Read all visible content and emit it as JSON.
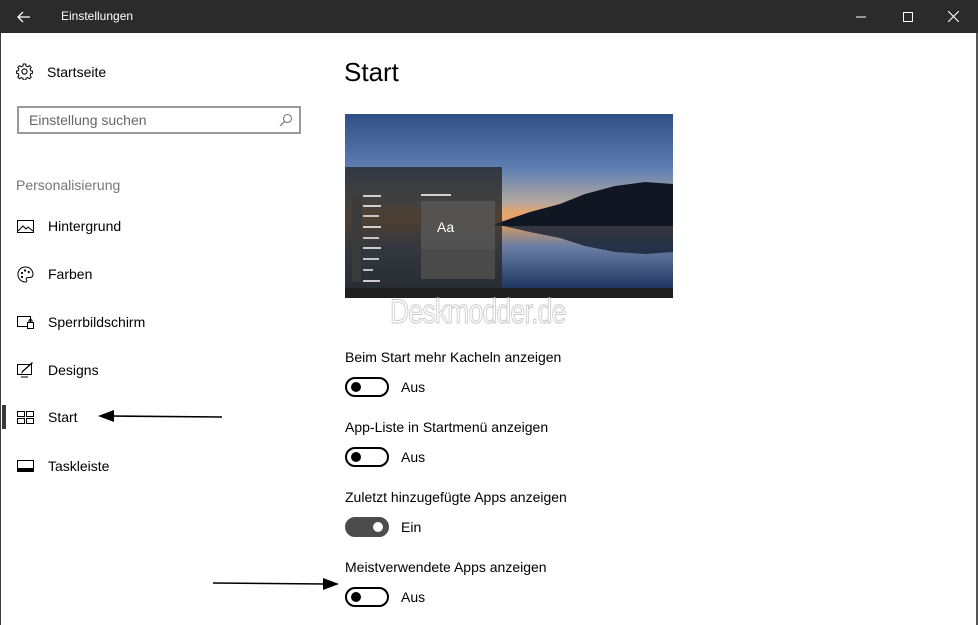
{
  "window": {
    "title": "Einstellungen"
  },
  "sidebar": {
    "home_label": "Startseite",
    "search_placeholder": "Einstellung suchen",
    "section_label": "Personalisierung",
    "items": [
      {
        "label": "Hintergrund",
        "icon": "picture-icon"
      },
      {
        "label": "Farben",
        "icon": "palette-icon"
      },
      {
        "label": "Sperrbildschirm",
        "icon": "lockscreen-icon"
      },
      {
        "label": "Designs",
        "icon": "designs-icon"
      },
      {
        "label": "Start",
        "icon": "start-tiles-icon",
        "selected": true
      },
      {
        "label": "Taskleiste",
        "icon": "taskbar-icon"
      }
    ]
  },
  "main": {
    "title": "Start",
    "preview": {
      "tile_text": "Aa",
      "watermark": "Deskmodder.de"
    },
    "settings": [
      {
        "label": "Beim Start mehr Kacheln anzeigen",
        "state": "Aus",
        "on": false
      },
      {
        "label": "App-Liste in Startmenü anzeigen",
        "state": "Aus",
        "on": false
      },
      {
        "label": "Zuletzt hinzugefügte Apps anzeigen",
        "state": "Ein",
        "on": true
      },
      {
        "label": "Meistverwendete Apps anzeigen",
        "state": "Aus",
        "on": false
      }
    ]
  },
  "colors": {
    "titlebar": "#2b2b2b",
    "toggle_on": "#4c4c4c"
  }
}
